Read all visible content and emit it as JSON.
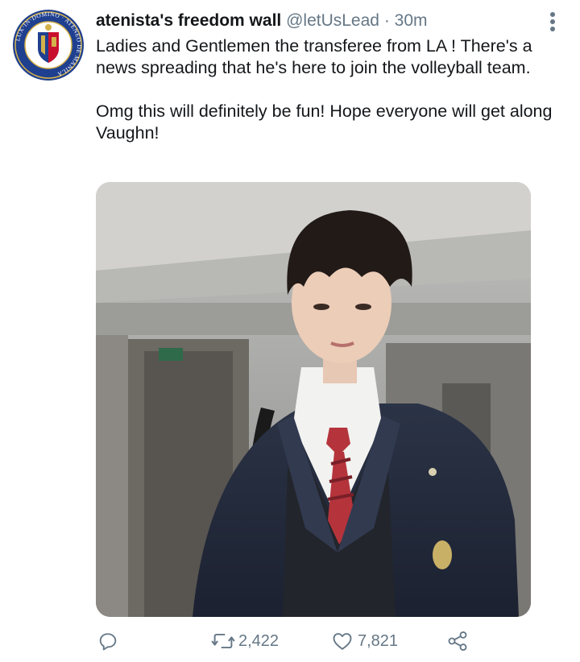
{
  "tweet": {
    "author_name": "atenista's freedom wall",
    "handle": "@letUsLead",
    "separator": "·",
    "timestamp": "30m",
    "paragraphs": [
      "Ladies and Gentlemen the transferee from LA ! There's a news spreading that he's here to join the volleyball team.",
      "Omg this will definitely be fun! Hope everyone will get along Vaughn!"
    ]
  },
  "avatar": {
    "icon": "ateneo-seal-logo",
    "seal_text": "LUX-IN-DOMINO · ATENEO DE MANILA"
  },
  "media": {
    "icon": "photo-student-in-uniform"
  },
  "actions": {
    "reply": {
      "icon": "reply-icon"
    },
    "retweet": {
      "icon": "retweet-icon",
      "count": "2,422"
    },
    "like": {
      "icon": "heart-icon",
      "count": "7,821"
    },
    "share": {
      "icon": "share-icon"
    }
  },
  "colors": {
    "text": "#14171a",
    "muted": "#657786",
    "seal_blue": "#1f3f8f",
    "seal_gold": "#d4b24a"
  }
}
